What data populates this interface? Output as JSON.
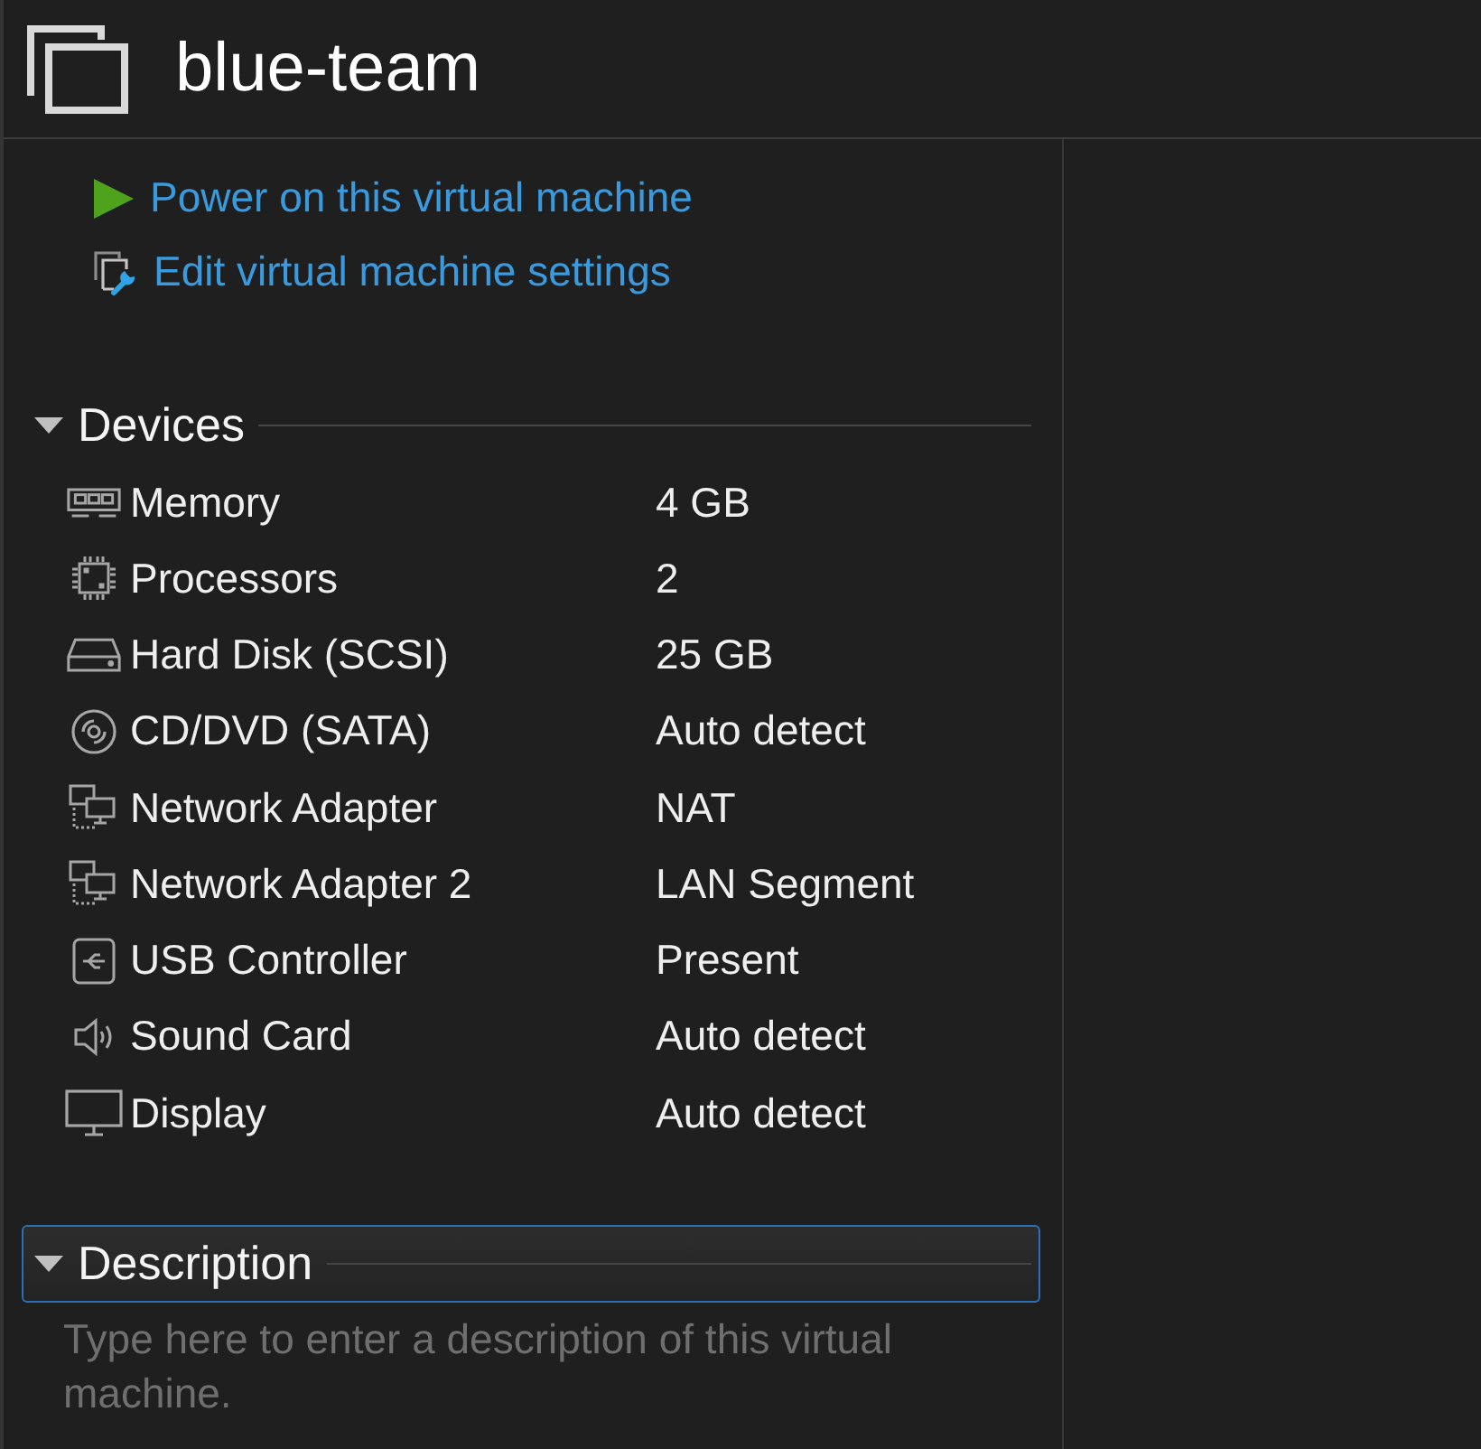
{
  "header": {
    "title": "blue-team"
  },
  "actions": [
    {
      "kind": "power",
      "label": "Power on this virtual machine"
    },
    {
      "kind": "settings",
      "label": "Edit virtual machine settings"
    }
  ],
  "sections": [
    {
      "kind": "devices",
      "title": "Devices",
      "expanded": true,
      "selected": false,
      "devices": [
        {
          "kind": "memory",
          "name": "Memory",
          "value": "4 GB"
        },
        {
          "kind": "processor",
          "name": "Processors",
          "value": "2"
        },
        {
          "kind": "disk",
          "name": "Hard Disk (SCSI)",
          "value": "25 GB"
        },
        {
          "kind": "cdrom",
          "name": "CD/DVD (SATA)",
          "value": "Auto detect"
        },
        {
          "kind": "network",
          "name": "Network Adapter",
          "value": "NAT"
        },
        {
          "kind": "network",
          "name": "Network Adapter 2",
          "value": "LAN Segment"
        },
        {
          "kind": "usb",
          "name": "USB Controller",
          "value": "Present"
        },
        {
          "kind": "sound",
          "name": "Sound Card",
          "value": "Auto detect"
        },
        {
          "kind": "display",
          "name": "Display",
          "value": "Auto detect"
        }
      ]
    },
    {
      "kind": "description",
      "title": "Description",
      "expanded": true,
      "selected": true,
      "placeholder": "Type here to enter a description of this virtual machine."
    }
  ]
}
